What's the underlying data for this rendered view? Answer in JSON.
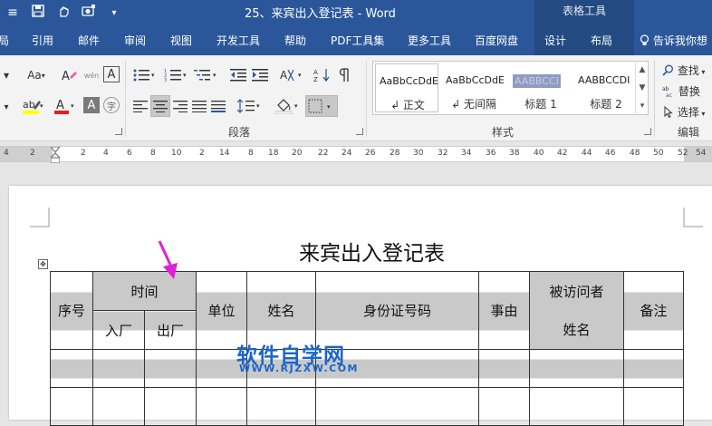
{
  "window": {
    "title": "25、来宾出入登记表  -  Word",
    "contextual_title": "表格工具"
  },
  "tabs": [
    "引用",
    "邮件",
    "审阅",
    "视图",
    "开发工具",
    "帮助",
    "PDF工具集",
    "更多工具",
    "百度网盘",
    "设计",
    "布局"
  ],
  "tab_partial_left": "局",
  "tell_me": "告诉我你想",
  "ribbon": {
    "font_size_label": "Aa",
    "wen_label": "wén",
    "paragraph_label": "段落",
    "styles_label": "样式",
    "editing_label": "编辑",
    "styles": [
      {
        "sample": "AaBbCcDdE",
        "name": "↲ 正文"
      },
      {
        "sample": "AaBbCcDdE",
        "name": "↲ 无间隔"
      },
      {
        "sample": "AABBCCI",
        "name": "标题 1"
      },
      {
        "sample": "AABBCCDI",
        "name": "标题 2"
      }
    ],
    "find": "查找",
    "replace": "替换",
    "select": "选择"
  },
  "ruler": {
    "ticks": [
      "4",
      "2",
      "2",
      "4",
      "6",
      "8",
      "10",
      "2",
      "14",
      "8",
      "18",
      "20",
      "22",
      "24",
      "26",
      "28",
      "30",
      "32",
      "34",
      "36",
      "38",
      "40",
      "42",
      "44",
      "46",
      "48",
      "50",
      "52",
      "54"
    ]
  },
  "document": {
    "heading": "来宾出入登记表",
    "table": {
      "col_seq": "序号",
      "col_time": "时间",
      "col_in": "入厂",
      "col_out": "出厂",
      "col_unit": "单位",
      "col_name": "姓名",
      "col_id": "身份证号码",
      "col_reason": "事由",
      "col_visited_1": "被访问者",
      "col_visited_2": "姓名",
      "col_note": "备注"
    }
  },
  "watermark": {
    "main": "软件自学网",
    "sub": "WWW.RJZXW.COM"
  },
  "colors": {
    "word_blue": "#2b579a",
    "shading": "#c9c9c9",
    "arrow": "#e020d8",
    "watermark": "#1a66c9"
  }
}
